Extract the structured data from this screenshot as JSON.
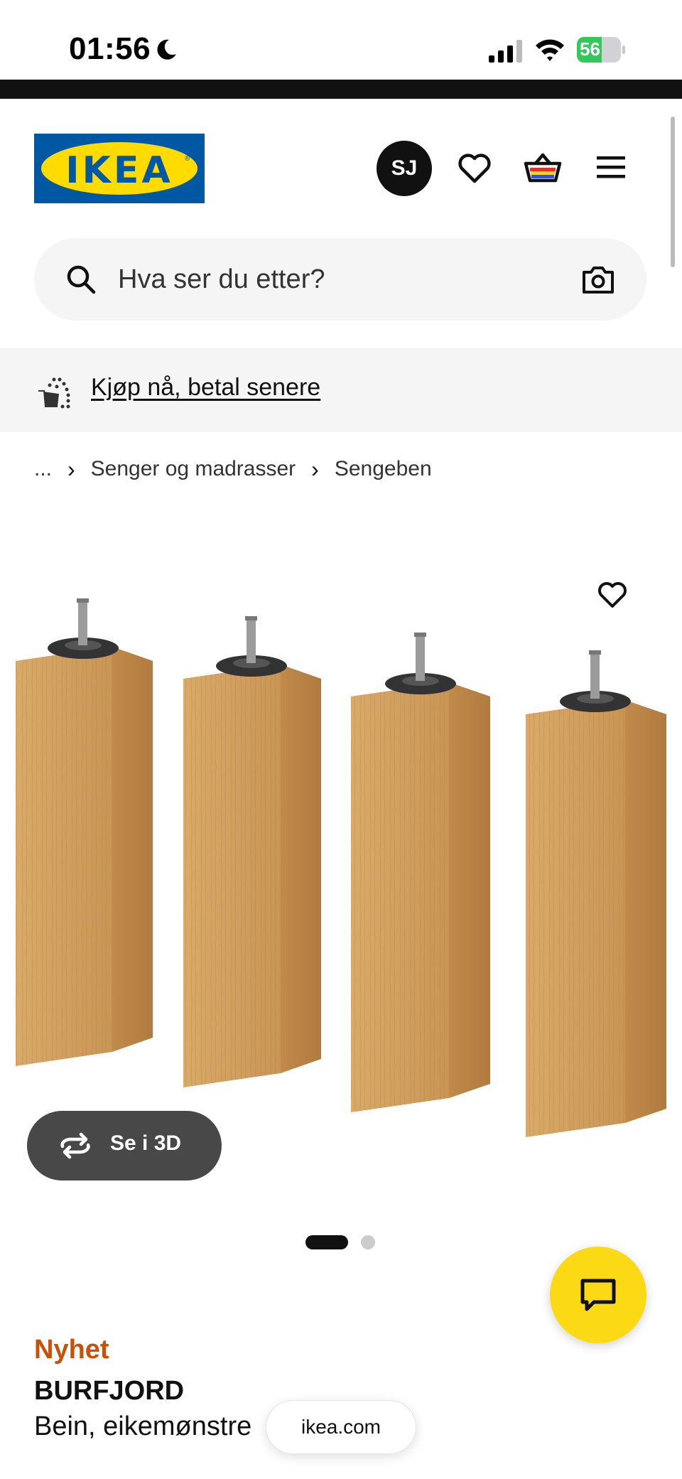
{
  "status_bar": {
    "time": "01:56",
    "battery_percent": "56",
    "battery_level": 0.56
  },
  "header": {
    "logo_text": "IKEA",
    "avatar_initials": "SJ"
  },
  "search": {
    "placeholder": "Hva ser du etter?"
  },
  "promo": {
    "link_label": "Kjøp nå, betal senere"
  },
  "breadcrumb": {
    "items": [
      "...",
      "Senger og madrasser",
      "Sengeben"
    ]
  },
  "product_image": {
    "view_3d_label": "Se i 3D",
    "carousel": {
      "total": 2,
      "active": 1
    }
  },
  "product": {
    "badge": "Nyhet",
    "name": "BURFJORD",
    "description": "Bein, eikemønstre"
  },
  "browser": {
    "url": "ikea.com"
  },
  "colors": {
    "ikea_blue": "#0058a3",
    "ikea_yellow": "#ffdb00",
    "new_orange": "#ca5008",
    "chat_yellow": "#fbd914",
    "battery_green": "#34c759"
  }
}
